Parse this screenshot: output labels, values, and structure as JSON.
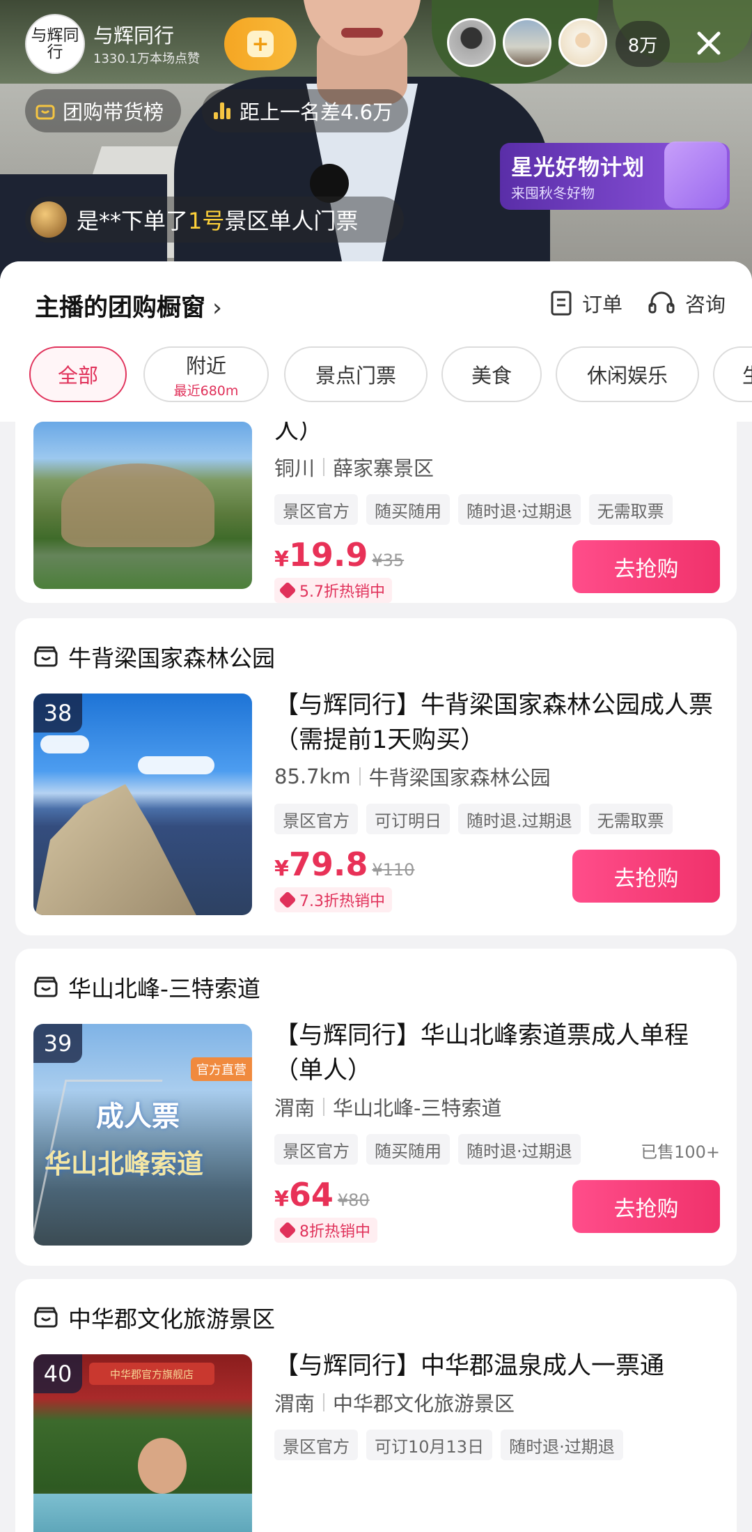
{
  "live": {
    "host_name": "与辉同行",
    "host_likes": "1330.1万本场点赞",
    "avatar_text": "与辉同行",
    "follow_icon": "+",
    "viewer_count": "8万",
    "rank_label": "团购带货榜",
    "rank_gap": "距上一名差4.6万",
    "order_msg_prefix": "是**下单了",
    "order_msg_highlight": "1号",
    "order_msg_suffix": "景区单人门票",
    "promo_title": "星光好物计划",
    "promo_sub": "来囤秋冬好物"
  },
  "sheet": {
    "title": "主播的团购橱窗",
    "title_chevron": "›",
    "order_label": "订单",
    "consult_label": "咨询",
    "chips": [
      {
        "label": "全部",
        "sub": ""
      },
      {
        "label": "附近",
        "sub": "最近680m"
      },
      {
        "label": "景点门票",
        "sub": ""
      },
      {
        "label": "美食",
        "sub": ""
      },
      {
        "label": "休闲娱乐",
        "sub": ""
      },
      {
        "label": "生",
        "sub": ""
      }
    ]
  },
  "items": [
    {
      "title_tail": "人）",
      "city": "铜川",
      "venue": "薛家寨景区",
      "tags": [
        "景区官方",
        "随买随用",
        "随时退·过期退",
        "无需取票"
      ],
      "price": "19.9",
      "original": "¥35",
      "discount": "5.7折热销中",
      "buy": "去抢购"
    },
    {
      "store": "牛背梁国家森林公园",
      "number": "38",
      "title": "【与辉同行】牛背梁国家森林公园成人票（需提前1天购买）",
      "city": "85.7km",
      "venue": "牛背梁国家森林公园",
      "tags": [
        "景区官方",
        "可订明日",
        "随时退.过期退",
        "无需取票"
      ],
      "price": "79.8",
      "original": "¥110",
      "discount": "7.3折热销中",
      "buy": "去抢购"
    },
    {
      "store": "华山北峰-三特索道",
      "number": "39",
      "title": "【与辉同行】华山北峰索道票成人单程（单人）",
      "city": "渭南",
      "venue": "华山北峰-三特索道",
      "tags": [
        "景区官方",
        "随买随用",
        "随时退·过期退"
      ],
      "sold": "已售100+",
      "price": "64",
      "original": "¥80",
      "discount": "8折热销中",
      "buy": "去抢购",
      "img_text_1": "成人票",
      "img_text_2": "华山北峰索道",
      "img_badge": "官方直营"
    },
    {
      "store": "中华郡文化旅游景区",
      "number": "40",
      "title": "【与辉同行】中华郡温泉成人一票通",
      "city": "渭南",
      "venue": "中华郡文化旅游景区",
      "tags": [
        "景区官方",
        "可订10月13日",
        "随时退·过期退"
      ],
      "img_banner": "中华郡官方旗舰店"
    }
  ],
  "currency": "¥",
  "colors": {
    "accent": "#e0315a",
    "buy_button": "#f0326b",
    "follow": "#f5a623",
    "promo": "#7a45d0"
  }
}
